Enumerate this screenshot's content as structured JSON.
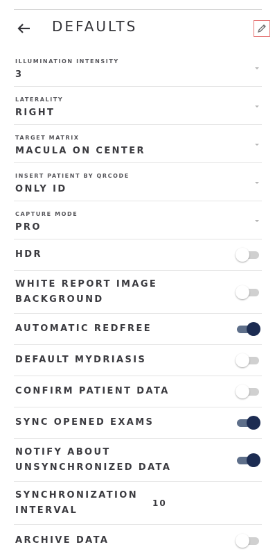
{
  "header": {
    "back_icon": "arrow-left-icon",
    "title": "DEFAULTS",
    "edit_icon": "pencil-icon",
    "edit_border_color": "#e57373"
  },
  "settings": {
    "illumination": {
      "label": "ILLUMINATION INTENSITY",
      "value": "3"
    },
    "laterality": {
      "label": "LATERALITY",
      "value": "RIGHT"
    },
    "target_matrix": {
      "label": "TARGET MATRIX",
      "value": "MACULA ON CENTER"
    },
    "insert_patient": {
      "label": "INSERT PATIENT BY QRCODE",
      "value": "ONLY ID"
    },
    "capture_mode": {
      "label": "CAPTURE MODE",
      "value": "PRO"
    }
  },
  "toggles": {
    "hdr": {
      "label": "HDR",
      "on": false
    },
    "white_report": {
      "label": "WHITE REPORT IMAGE BACKGROUND",
      "on": false
    },
    "auto_redfree": {
      "label": "AUTOMATIC REDFREE",
      "on": true
    },
    "default_mydriasis": {
      "label": "DEFAULT MYDRIASIS",
      "on": false
    },
    "confirm_patient": {
      "label": "CONFIRM PATIENT DATA",
      "on": false
    },
    "sync_opened": {
      "label": "SYNC OPENED EXAMS",
      "on": true
    },
    "notify_unsync": {
      "label": "NOTIFY ABOUT UNSYNCHRONIZED DATA",
      "on": true
    },
    "archive_data": {
      "label": "ARCHIVE DATA",
      "on": false
    }
  },
  "sync_interval": {
    "label": "SYNCHRONIZATION INTERVAL",
    "value": "10"
  },
  "colors": {
    "toggle_on_thumb": "#1c2c52",
    "toggle_on_track": "#5e6f8a",
    "toggle_off_track": "#d0d0d0"
  }
}
